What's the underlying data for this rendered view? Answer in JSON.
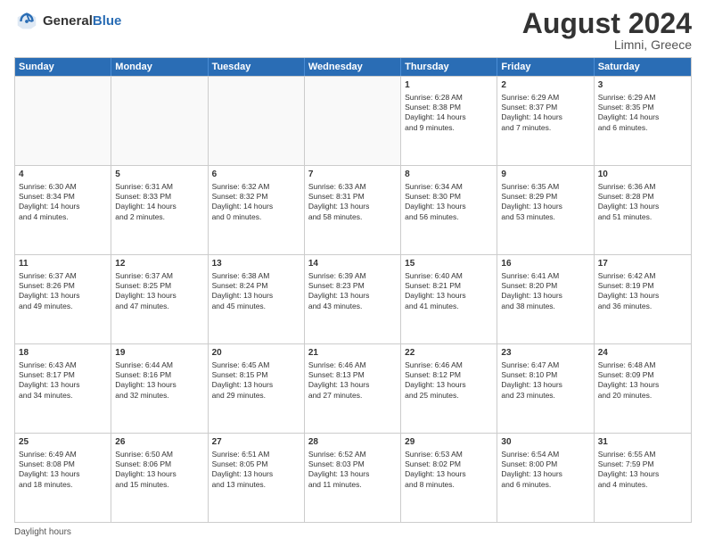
{
  "header": {
    "logo_general": "General",
    "logo_blue": "Blue",
    "month_year": "August 2024",
    "location": "Limni, Greece"
  },
  "weekdays": [
    "Sunday",
    "Monday",
    "Tuesday",
    "Wednesday",
    "Thursday",
    "Friday",
    "Saturday"
  ],
  "footer": {
    "daylight_label": "Daylight hours"
  },
  "rows": [
    [
      {
        "day": "",
        "empty": true
      },
      {
        "day": "",
        "empty": true
      },
      {
        "day": "",
        "empty": true
      },
      {
        "day": "",
        "empty": true
      },
      {
        "day": "1",
        "lines": [
          "Sunrise: 6:28 AM",
          "Sunset: 8:38 PM",
          "Daylight: 14 hours",
          "and 9 minutes."
        ]
      },
      {
        "day": "2",
        "lines": [
          "Sunrise: 6:29 AM",
          "Sunset: 8:37 PM",
          "Daylight: 14 hours",
          "and 7 minutes."
        ]
      },
      {
        "day": "3",
        "lines": [
          "Sunrise: 6:29 AM",
          "Sunset: 8:35 PM",
          "Daylight: 14 hours",
          "and 6 minutes."
        ]
      }
    ],
    [
      {
        "day": "4",
        "lines": [
          "Sunrise: 6:30 AM",
          "Sunset: 8:34 PM",
          "Daylight: 14 hours",
          "and 4 minutes."
        ]
      },
      {
        "day": "5",
        "lines": [
          "Sunrise: 6:31 AM",
          "Sunset: 8:33 PM",
          "Daylight: 14 hours",
          "and 2 minutes."
        ]
      },
      {
        "day": "6",
        "lines": [
          "Sunrise: 6:32 AM",
          "Sunset: 8:32 PM",
          "Daylight: 14 hours",
          "and 0 minutes."
        ]
      },
      {
        "day": "7",
        "lines": [
          "Sunrise: 6:33 AM",
          "Sunset: 8:31 PM",
          "Daylight: 13 hours",
          "and 58 minutes."
        ]
      },
      {
        "day": "8",
        "lines": [
          "Sunrise: 6:34 AM",
          "Sunset: 8:30 PM",
          "Daylight: 13 hours",
          "and 56 minutes."
        ]
      },
      {
        "day": "9",
        "lines": [
          "Sunrise: 6:35 AM",
          "Sunset: 8:29 PM",
          "Daylight: 13 hours",
          "and 53 minutes."
        ]
      },
      {
        "day": "10",
        "lines": [
          "Sunrise: 6:36 AM",
          "Sunset: 8:28 PM",
          "Daylight: 13 hours",
          "and 51 minutes."
        ]
      }
    ],
    [
      {
        "day": "11",
        "lines": [
          "Sunrise: 6:37 AM",
          "Sunset: 8:26 PM",
          "Daylight: 13 hours",
          "and 49 minutes."
        ]
      },
      {
        "day": "12",
        "lines": [
          "Sunrise: 6:37 AM",
          "Sunset: 8:25 PM",
          "Daylight: 13 hours",
          "and 47 minutes."
        ]
      },
      {
        "day": "13",
        "lines": [
          "Sunrise: 6:38 AM",
          "Sunset: 8:24 PM",
          "Daylight: 13 hours",
          "and 45 minutes."
        ]
      },
      {
        "day": "14",
        "lines": [
          "Sunrise: 6:39 AM",
          "Sunset: 8:23 PM",
          "Daylight: 13 hours",
          "and 43 minutes."
        ]
      },
      {
        "day": "15",
        "lines": [
          "Sunrise: 6:40 AM",
          "Sunset: 8:21 PM",
          "Daylight: 13 hours",
          "and 41 minutes."
        ]
      },
      {
        "day": "16",
        "lines": [
          "Sunrise: 6:41 AM",
          "Sunset: 8:20 PM",
          "Daylight: 13 hours",
          "and 38 minutes."
        ]
      },
      {
        "day": "17",
        "lines": [
          "Sunrise: 6:42 AM",
          "Sunset: 8:19 PM",
          "Daylight: 13 hours",
          "and 36 minutes."
        ]
      }
    ],
    [
      {
        "day": "18",
        "lines": [
          "Sunrise: 6:43 AM",
          "Sunset: 8:17 PM",
          "Daylight: 13 hours",
          "and 34 minutes."
        ]
      },
      {
        "day": "19",
        "lines": [
          "Sunrise: 6:44 AM",
          "Sunset: 8:16 PM",
          "Daylight: 13 hours",
          "and 32 minutes."
        ]
      },
      {
        "day": "20",
        "lines": [
          "Sunrise: 6:45 AM",
          "Sunset: 8:15 PM",
          "Daylight: 13 hours",
          "and 29 minutes."
        ]
      },
      {
        "day": "21",
        "lines": [
          "Sunrise: 6:46 AM",
          "Sunset: 8:13 PM",
          "Daylight: 13 hours",
          "and 27 minutes."
        ]
      },
      {
        "day": "22",
        "lines": [
          "Sunrise: 6:46 AM",
          "Sunset: 8:12 PM",
          "Daylight: 13 hours",
          "and 25 minutes."
        ]
      },
      {
        "day": "23",
        "lines": [
          "Sunrise: 6:47 AM",
          "Sunset: 8:10 PM",
          "Daylight: 13 hours",
          "and 23 minutes."
        ]
      },
      {
        "day": "24",
        "lines": [
          "Sunrise: 6:48 AM",
          "Sunset: 8:09 PM",
          "Daylight: 13 hours",
          "and 20 minutes."
        ]
      }
    ],
    [
      {
        "day": "25",
        "lines": [
          "Sunrise: 6:49 AM",
          "Sunset: 8:08 PM",
          "Daylight: 13 hours",
          "and 18 minutes."
        ]
      },
      {
        "day": "26",
        "lines": [
          "Sunrise: 6:50 AM",
          "Sunset: 8:06 PM",
          "Daylight: 13 hours",
          "and 15 minutes."
        ]
      },
      {
        "day": "27",
        "lines": [
          "Sunrise: 6:51 AM",
          "Sunset: 8:05 PM",
          "Daylight: 13 hours",
          "and 13 minutes."
        ]
      },
      {
        "day": "28",
        "lines": [
          "Sunrise: 6:52 AM",
          "Sunset: 8:03 PM",
          "Daylight: 13 hours",
          "and 11 minutes."
        ]
      },
      {
        "day": "29",
        "lines": [
          "Sunrise: 6:53 AM",
          "Sunset: 8:02 PM",
          "Daylight: 13 hours",
          "and 8 minutes."
        ]
      },
      {
        "day": "30",
        "lines": [
          "Sunrise: 6:54 AM",
          "Sunset: 8:00 PM",
          "Daylight: 13 hours",
          "and 6 minutes."
        ]
      },
      {
        "day": "31",
        "lines": [
          "Sunrise: 6:55 AM",
          "Sunset: 7:59 PM",
          "Daylight: 13 hours",
          "and 4 minutes."
        ]
      }
    ]
  ]
}
